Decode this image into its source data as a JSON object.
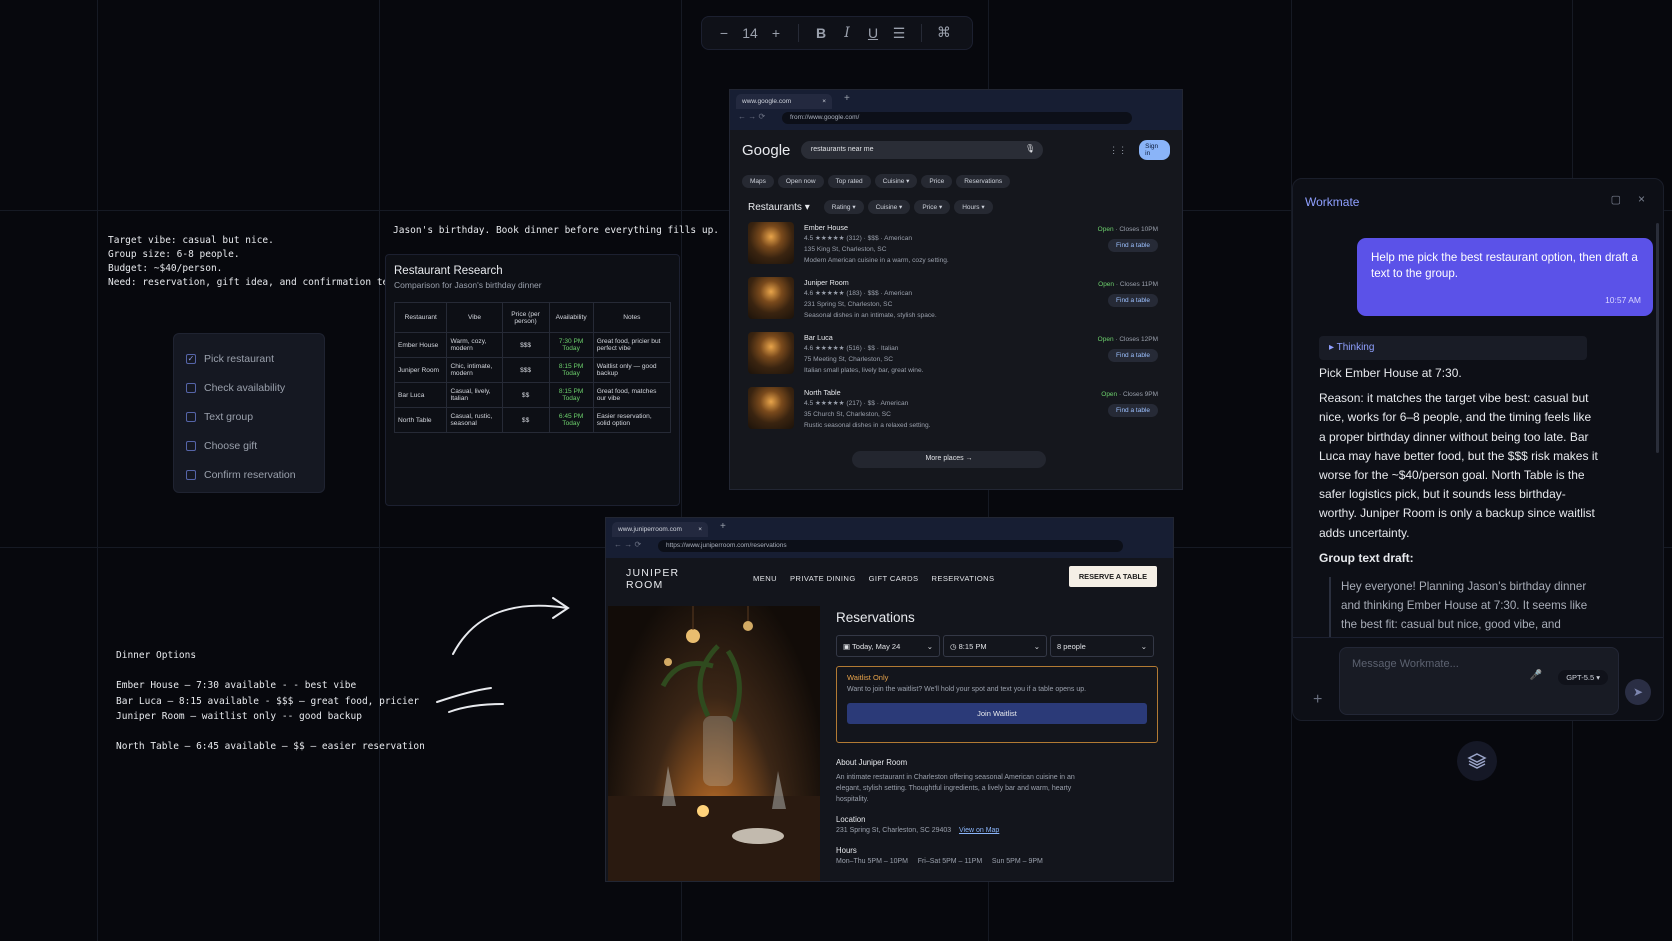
{
  "toolbar": {
    "minus": "−",
    "font_size": "14",
    "plus": "+",
    "bold": "B",
    "italic": "I",
    "underline": "U",
    "list": "☰",
    "command": "⌘"
  },
  "notes": {
    "brief": "Target vibe: casual but nice.\nGroup size: 6-8 people.\nBudget: ~$40/person.\nNeed: reservation, gift idea, and confirmation text.",
    "header": "Jason's birthday. Book dinner before everything fills up.",
    "dinner_options": "Dinner Options\n\nEmber House — 7:30 available - - best vibe\nBar Luca — 8:15 available - $$$ — great food, pricier\nJuniper Room — waitlist only -- good backup\n\nNorth Table — 6:45 available — $$ — easier reservation"
  },
  "todo": [
    {
      "label": "Pick restaurant",
      "checked": true
    },
    {
      "label": "Check availability",
      "checked": false
    },
    {
      "label": "Text group",
      "checked": false
    },
    {
      "label": "Choose gift",
      "checked": false
    },
    {
      "label": "Confirm reservation",
      "checked": false
    }
  ],
  "research": {
    "title": "Restaurant Research",
    "subtitle": "Comparison for Jason's birthday dinner",
    "headers": [
      "Restaurant",
      "Vibe",
      "Price (per person)",
      "Availability",
      "Notes"
    ],
    "rows": [
      {
        "name": "Ember House",
        "vibe": "Warm, cozy, modern",
        "price": "$$$",
        "time": "7:30 PM",
        "day": "Today",
        "notes": "Great food, pricier but perfect vibe"
      },
      {
        "name": "Juniper Room",
        "vibe": "Chic, intimate, modern",
        "price": "$$$",
        "time": "8:15 PM",
        "day": "Today",
        "notes": "Waitlist only — good backup"
      },
      {
        "name": "Bar Luca",
        "vibe": "Casual, lively, Italian",
        "price": "$$",
        "time": "8:15 PM",
        "day": "Today",
        "notes": "Great food, matches our vibe"
      },
      {
        "name": "North Table",
        "vibe": "Casual, rustic, seasonal",
        "price": "$$",
        "time": "6:45 PM",
        "day": "Today",
        "notes": "Easier reservation, solid option"
      }
    ]
  },
  "google": {
    "tab": "www.google.com",
    "url": "from://www.google.com/",
    "logo": "Google",
    "query": "restaurants near me",
    "signin": "Sign in",
    "chips": [
      "Maps",
      "Open now",
      "Top rated",
      "Cuisine ▾",
      "Price",
      "Reservations"
    ],
    "section": "Restaurants ▾",
    "filters": [
      "Rating ▾",
      "Cuisine ▾",
      "Price ▾",
      "Hours ▾"
    ],
    "results": [
      {
        "name": "Ember House",
        "meta": "4.5 ★★★★★ (312) · $$$ · American",
        "addr": "135 King St, Charleston, SC",
        "snip": "Modern American cuisine in a warm, cozy setting.",
        "open": "Open",
        "close": " · Closes 10PM",
        "btn": "Find a table"
      },
      {
        "name": "Juniper Room",
        "meta": "4.6 ★★★★★ (183) · $$$ · American",
        "addr": "231 Spring St, Charleston, SC",
        "snip": "Seasonal dishes in an intimate, stylish space.",
        "open": "Open",
        "close": " · Closes 11PM",
        "btn": "Find a table"
      },
      {
        "name": "Bar Luca",
        "meta": "4.6 ★★★★★ (516) · $$ · Italian",
        "addr": "75 Meeting St, Charleston, SC",
        "snip": "Italian small plates, lively bar, great wine.",
        "open": "Open",
        "close": " · Closes 12PM",
        "btn": "Find a table"
      },
      {
        "name": "North Table",
        "meta": "4.5 ★★★★★ (217) · $$ · American",
        "addr": "35 Church St, Charleston, SC",
        "snip": "Rustic seasonal dishes in a relaxed setting.",
        "open": "Open",
        "close": " · Closes 9PM",
        "btn": "Find a table"
      }
    ],
    "more": "More places  →"
  },
  "juniper": {
    "tab": "www.juniperroom.com",
    "url": "https://www.juniperroom.com/reservations",
    "logo_line1": "JUNIPER",
    "logo_line2": "ROOM",
    "nav": [
      "MENU",
      "PRIVATE DINING",
      "GIFT CARDS",
      "RESERVATIONS"
    ],
    "reserve_btn": "RESERVE A TABLE",
    "res_title": "Reservations",
    "date": "Today, May 24",
    "time": "8:15 PM",
    "party": "8 people",
    "wait_title": "Waitlist Only",
    "wait_text": "Want to join the waitlist? We'll hold your spot and text you if a table opens up.",
    "join": "Join Waitlist",
    "about_h": "About Juniper Room",
    "about_t": "An intimate restaurant in Charleston offering seasonal American cuisine in an elegant, stylish setting. Thoughtful ingredients, a lively bar and warm, hearty hospitality.",
    "loc_h": "Location",
    "loc_t": "231 Spring St, Charleston, SC 29403",
    "map": "View on Map",
    "hours_h": "Hours",
    "hours_t": "Mon–Thu 5PM – 10PM     Fri–Sat 5PM – 11PM     Sun 5PM – 9PM"
  },
  "workmate": {
    "title": "Workmate",
    "user_msg": "Help me pick the best restaurant option, then draft a text to the group.",
    "time": "10:57 AM",
    "thinking": "▸  Thinking",
    "pick": "Pick Ember House at 7:30.",
    "reason": "Reason: it matches the target vibe best: casual but nice, works for 6–8 people, and the timing feels like a proper birthday dinner without being too late. Bar Luca may have better food, but the $$$ risk makes it worse for the ~$40/person goal. North Table is the safer logistics pick, but it sounds less birthday-worthy. Juniper Room is only a backup since waitlist adds uncertainty.",
    "draft_h": "Group text draft:",
    "draft": "Hey everyone! Planning Jason's birthday dinner and thinking Ember House at 7:30. It seems like the best fit: casual but nice, good vibe, and",
    "placeholder": "Message Workmate...",
    "model": "GPT-5.5 ▾"
  },
  "colors": {
    "accent": "#5b52e8",
    "open": "#6cd06c",
    "star": "#f2b134"
  }
}
